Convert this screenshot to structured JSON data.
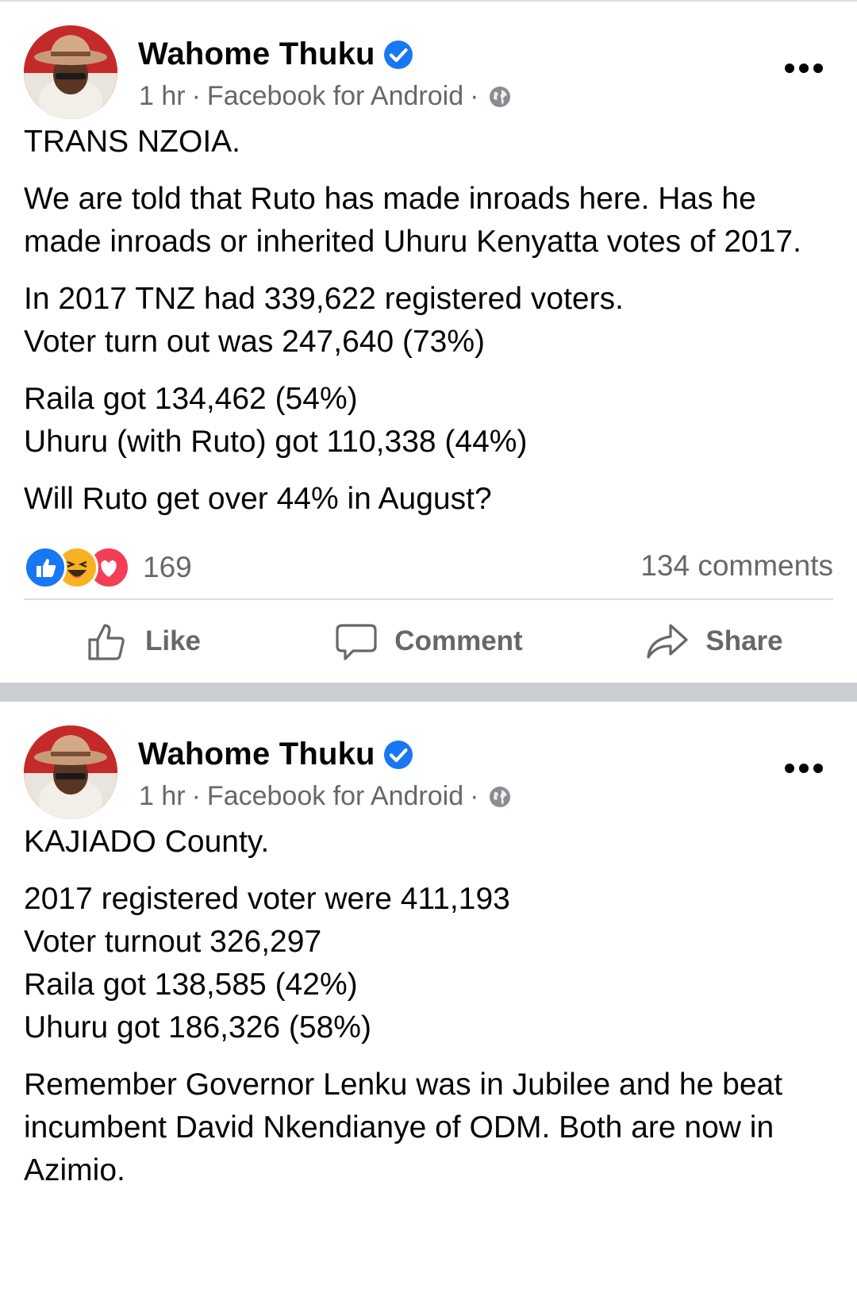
{
  "posts": [
    {
      "author": "Wahome Thuku",
      "time": "1 hr",
      "source": "Facebook for Android",
      "dot": "·",
      "paragraphs": [
        "TRANS NZOIA.",
        "We are told that Ruto has made inroads here. Has he made inroads or inherited Uhuru Kenyatta votes of 2017.",
        "In 2017 TNZ had 339,622 registered voters.\nVoter turn out was 247,640 (73%)",
        "Raila got 134,462 (54%)\nUhuru (with Ruto) got 110,338 (44%)",
        "Will Ruto get over 44% in August?"
      ],
      "reaction_count": "169",
      "comments": "134 comments",
      "actions": {
        "like": "Like",
        "comment": "Comment",
        "share": "Share"
      }
    },
    {
      "author": "Wahome Thuku",
      "time": "1 hr",
      "source": "Facebook for Android",
      "dot": "·",
      "paragraphs": [
        "KAJIADO County.",
        "2017 registered voter were 411,193\nVoter turnout 326,297\nRaila got 138,585 (42%)\nUhuru got 186,326 (58%)",
        "Remember Governor Lenku was in Jubilee and he beat incumbent David Nkendianye of ODM. Both are now in Azimio."
      ]
    }
  ],
  "colors": {
    "accent": "#1877f2",
    "secondary_text": "#65676b",
    "separator": "#cacdd2"
  },
  "icons": {
    "verified": "verified-badge-icon",
    "globe": "globe-icon",
    "more": "more-options-icon",
    "like": "thumbs-up-icon",
    "comment": "comment-bubble-icon",
    "share": "share-arrow-icon"
  }
}
